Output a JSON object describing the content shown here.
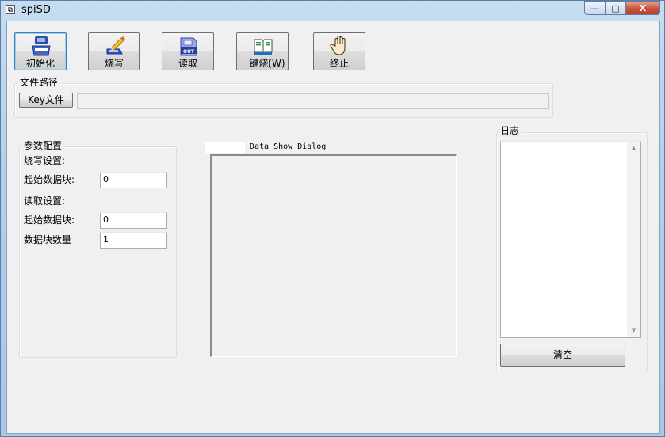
{
  "window": {
    "title": "spiSD",
    "icon": "app-icon"
  },
  "window_controls": {
    "minimize": "—",
    "maximize": "□",
    "close": "X"
  },
  "toolbar": [
    {
      "name": "init-button",
      "label": "初始化",
      "icon": "usb-drive-icon"
    },
    {
      "name": "write-button",
      "label": "烧写",
      "icon": "pencil-write-icon"
    },
    {
      "name": "read-button",
      "label": "读取",
      "icon": "out-drive-icon"
    },
    {
      "name": "one-key-burn-button",
      "label": "一键烧(W)",
      "icon": "book-icon"
    },
    {
      "name": "stop-button",
      "label": "终止",
      "icon": "hand-stop-icon"
    }
  ],
  "file_path": {
    "group_title": "文件路径",
    "key_button": "Key文件",
    "path_value": ""
  },
  "params": {
    "group_title": "参数配置",
    "write_settings_label": "烧写设置:",
    "write_start_block_label": "起始数据块:",
    "write_start_block_value": "0",
    "read_settings_label": "读取设置:",
    "read_start_block_label": "起始数据块:",
    "read_start_block_value": "0",
    "block_count_label": "数据块数量",
    "block_count_value": "1"
  },
  "data_show": {
    "title": "Data Show Dialog"
  },
  "log": {
    "group_title": "日志",
    "clear_button": "清空"
  }
}
